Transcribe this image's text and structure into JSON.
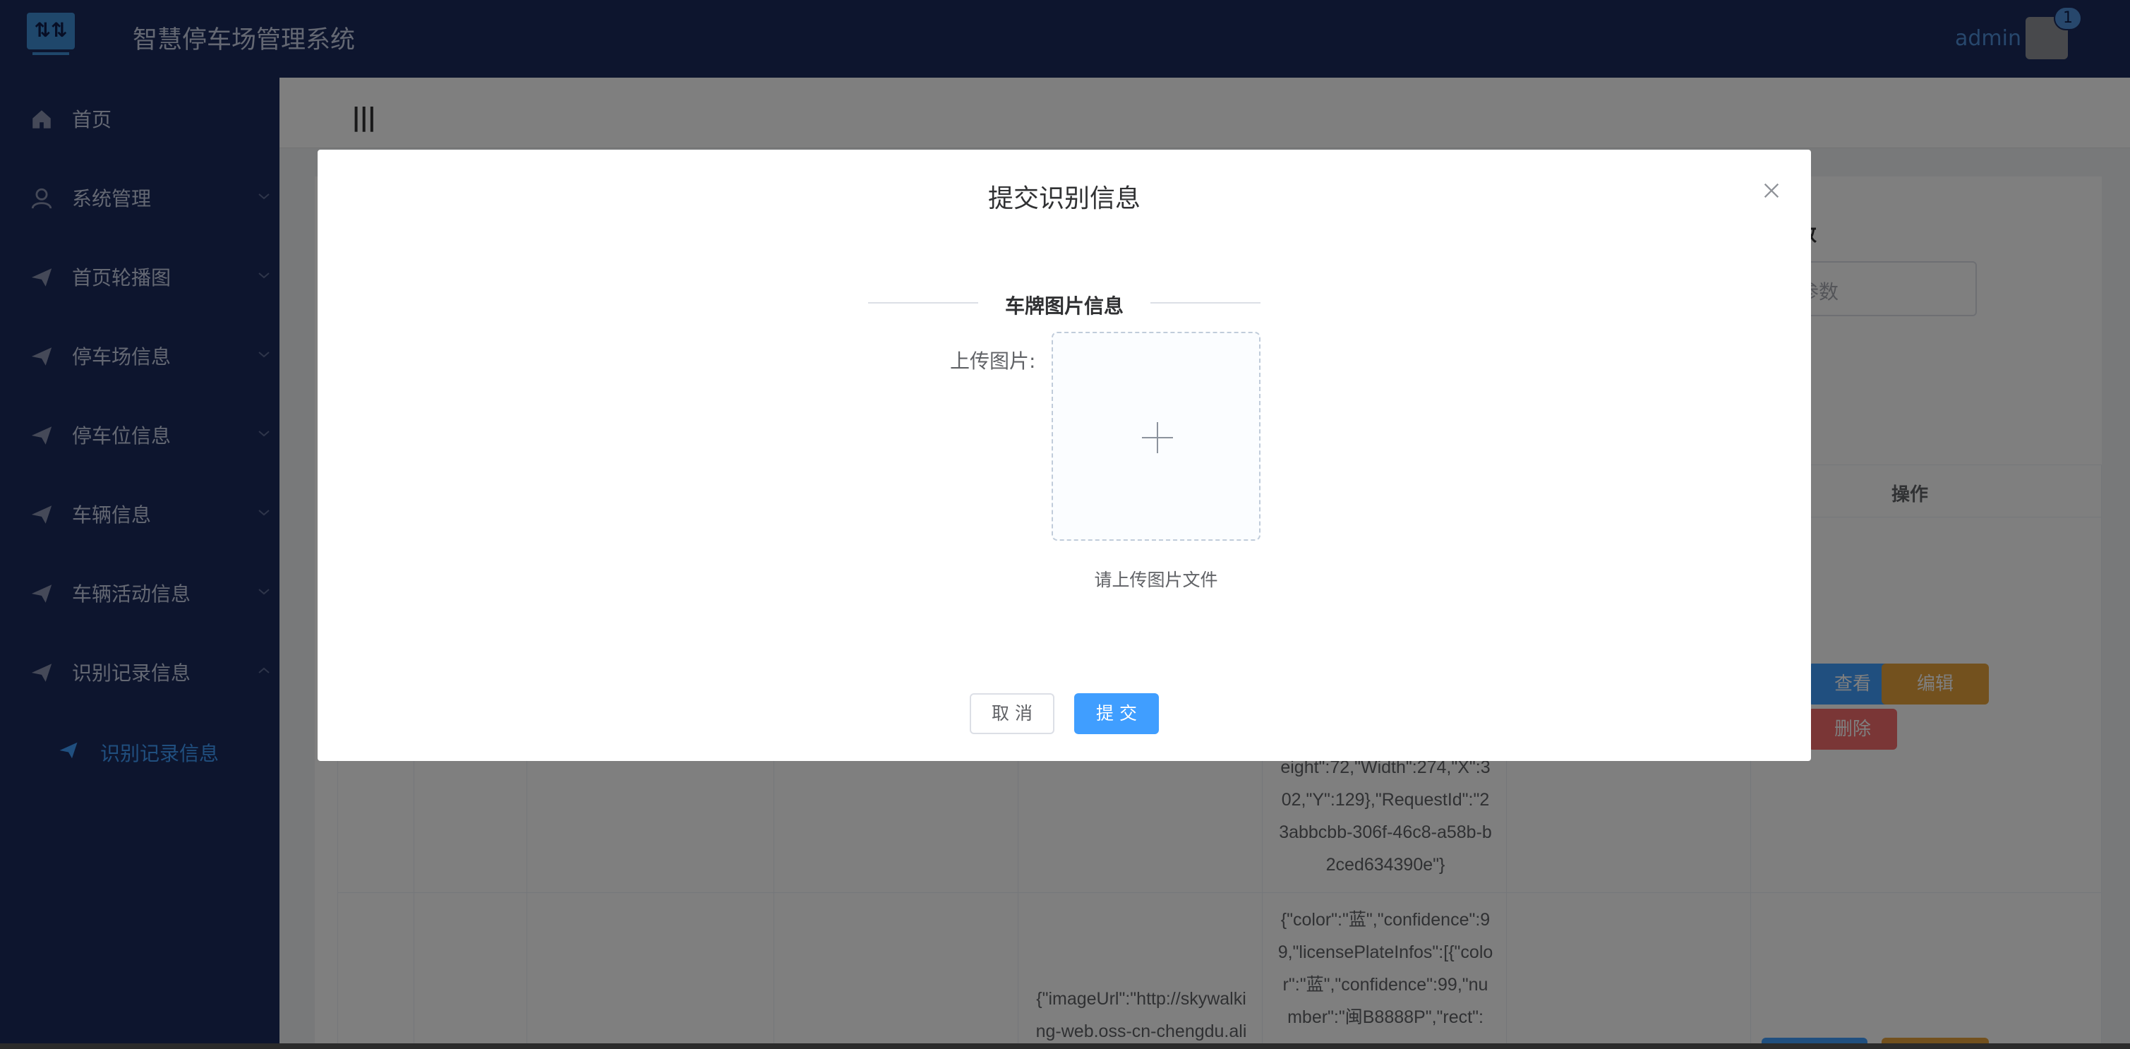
{
  "app": {
    "title": "智慧停车场管理系统",
    "logo_glyph": "⇅⇅",
    "username": "admin",
    "badge_count": "1"
  },
  "sidebar": {
    "items": [
      {
        "label": "首页",
        "icon": "home-icon"
      },
      {
        "label": "系统管理",
        "icon": "user-icon"
      },
      {
        "label": "首页轮播图",
        "icon": "send-icon"
      },
      {
        "label": "停车场信息",
        "icon": "send-icon"
      },
      {
        "label": "停车位信息",
        "icon": "send-icon"
      },
      {
        "label": "车辆信息",
        "icon": "send-icon"
      },
      {
        "label": "车辆活动信息",
        "icon": "send-icon"
      },
      {
        "label": "识别记录信息",
        "icon": "send-icon",
        "expanded": true
      }
    ],
    "active_sub": {
      "label": "识别记录信息",
      "icon": "send-icon"
    }
  },
  "main": {
    "hamburger": "|||",
    "search_label_fragment": "数",
    "search_placeholder_fragment": "参数",
    "table": {
      "op_header": "操作",
      "row1_json_tail": "eight\":72,\"Width\":274,\"X\":3\n02,\"Y\":129},\"RequestId\":\"2\n3abbcbb-306f-46c8-a58b-b\n2ced634390e\"}",
      "row1_partial": "\"}",
      "row2_image_url": "{\"imageUrl\":\"http://skywalki\nng-web.oss-cn-chengdu.ali",
      "row2_json": "{\"color\":\"蓝\",\"confidence\":9\n9,\"licensePlateInfos\":[{\"colo\nr\":\"蓝\",\"confidence\":99,\"nu\nmber\":\"闽B8888P\",\"rect\":",
      "view_label": "查看",
      "edit_label": "编辑",
      "delete_label": "删除"
    }
  },
  "dialog": {
    "title": "提交识别信息",
    "section_title": "车牌图片信息",
    "upload_label": "上传图片:",
    "upload_hint": "请上传图片文件",
    "cancel_label": "取 消",
    "submit_label": "提 交"
  },
  "colors": {
    "nav_bg": "#1b2a5c",
    "primary": "#409eff",
    "warning": "#e6a23c",
    "danger": "#f56c6c"
  }
}
